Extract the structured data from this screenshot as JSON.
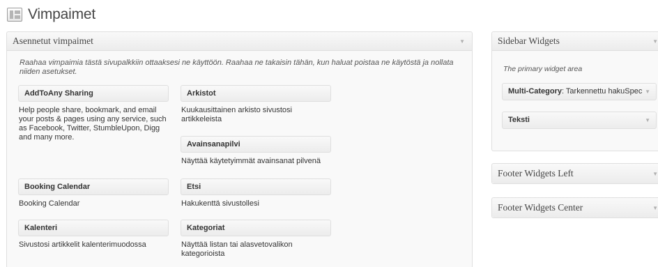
{
  "page": {
    "title": "Vimpaimet",
    "icon": "widgets-screen-icon"
  },
  "available": {
    "title": "Asennetut vimpaimet",
    "description": "Raahaa vimpaimia tästä sivupalkkiin ottaaksesi ne käyttöön. Raahaa ne takaisin tähän, kun haluat poistaa ne käytöstä ja nollata niiden asetukset.",
    "widgets": [
      {
        "title": "AddToAny Sharing",
        "desc": "Help people share, bookmark, and email your posts & pages using any service, such as Facebook, Twitter, StumbleUpon, Digg and many more."
      },
      {
        "title": "Arkistot",
        "desc": "Kuukausittainen arkisto sivustosi artikkeleista"
      },
      {
        "title": "Avainsanapilvi",
        "desc": "Näyttää käytetyimmät avainsanat pilvenä"
      },
      {
        "title": "Booking Calendar",
        "desc": "Booking Calendar"
      },
      {
        "title": "Etsi",
        "desc": "Hakukenttä sivustollesi"
      },
      {
        "title": "Kalenteri",
        "desc": "Sivustosi artikkelit kalenterimuodossa"
      },
      {
        "title": "Kategoriat",
        "desc": "Näyttää listan tai alasvetovalikon kategorioista"
      }
    ]
  },
  "sidebar": {
    "title": "Sidebar Widgets",
    "area_desc": "The primary widget area",
    "widgets": [
      {
        "title": "Multi-Category",
        "subtitle": ": Tarkennettu hakuSpec"
      },
      {
        "title": "Teksti",
        "subtitle": ""
      }
    ]
  },
  "footer_left": {
    "title": "Footer Widgets Left"
  },
  "footer_center": {
    "title": "Footer Widgets Center"
  },
  "arrow_glyph": "▼"
}
